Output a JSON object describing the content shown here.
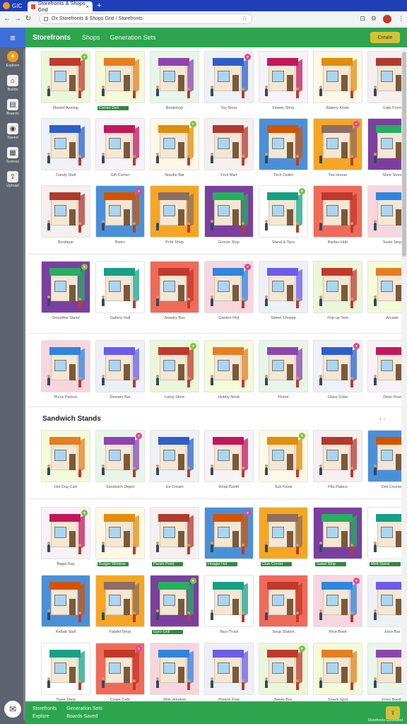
{
  "window": {
    "app_label": "GIC"
  },
  "tab": {
    "title": "Storefronts & Shops Grid",
    "close": "×",
    "new_tab": "+"
  },
  "address_bar": {
    "url": "Ox Storefronts & Shops Grid / Storefronts"
  },
  "sidebar": {
    "menu_icon": "menu-icon",
    "items": [
      {
        "label": "Explore",
        "icon": "bulb-icon",
        "glyph": "✦",
        "active": true
      },
      {
        "label": "Builds",
        "icon": "home-icon",
        "glyph": "⌂",
        "active": false
      },
      {
        "label": "Boards",
        "icon": "board-icon",
        "glyph": "▤",
        "active": false
      },
      {
        "label": "Saved",
        "icon": "pin-icon",
        "glyph": "◉",
        "active": false
      },
      {
        "label": "Scenes",
        "icon": "grid-icon",
        "glyph": "▦",
        "active": false
      },
      {
        "label": "Upload",
        "icon": "upload-icon",
        "glyph": "⇪",
        "active": false
      }
    ],
    "bottom_icon": "chat-icon"
  },
  "header": {
    "title": "Storefronts",
    "links": [
      "Shops",
      "Generation Sets"
    ],
    "button": "Create"
  },
  "section": {
    "title": "Sandwich Stands",
    "menu": "· ·"
  },
  "rows": [
    {
      "captions": [
        "Market Awning",
        "Corner Deli",
        "Bookshop",
        "Toy Store",
        "Flower Shop",
        "Bakery Kiosk",
        "Cafe Front"
      ],
      "green": [
        0,
        1,
        0,
        0,
        0,
        0,
        0
      ]
    },
    {
      "captions": [
        "Candy Stall",
        "Gift Corner",
        "Noodle Bar",
        "Fruit Mart",
        "Tech Outlet",
        "Tea House",
        "Shoe Store"
      ],
      "green": [
        0,
        0,
        0,
        0,
        0,
        0,
        0
      ]
    },
    {
      "captions": [
        "Boutique",
        "Bistro",
        "Print Shop",
        "Grocer Stop",
        "Stand & Taco",
        "Barber Hub",
        "Sushi Stop"
      ],
      "green": [
        0,
        0,
        0,
        0,
        0,
        0,
        0
      ]
    },
    {
      "captions": [
        "Smoothie Stand",
        "Gallery Hall",
        "Jewelry Box",
        "Garden Plot",
        "Sweet Shoppe",
        "Pop-up Tent",
        "Arcade"
      ],
      "green": [
        0,
        0,
        0,
        0,
        0,
        0,
        0
      ]
    },
    {
      "captions": [
        "Pizza Parlour",
        "Dessert Bar",
        "Lamp Store",
        "Hobby Nook",
        "Florist",
        "Glass Cube",
        "Diner Row"
      ],
      "green": [
        0,
        0,
        0,
        0,
        0,
        0,
        0
      ]
    },
    {
      "captions": [
        "Hot Dog Cart",
        "Sandwich Depot",
        "Ice Cream",
        "Wrap Booth",
        "Sub Kiosk",
        "Pita Palace",
        "Deli Counter"
      ],
      "green": [
        0,
        0,
        0,
        0,
        0,
        0,
        0
      ]
    },
    {
      "captions": [
        "Bagel Bay",
        "Burger Window",
        "Panini Point",
        "Hoagie Hut",
        "Club Corner",
        "Salad Stop",
        "Melt Stand"
      ],
      "green": [
        0,
        1,
        1,
        1,
        1,
        1,
        1
      ]
    },
    {
      "captions": [
        "Kebab Stall",
        "Falafel Shop",
        "Gyro Grill",
        "Taco Truck",
        "Soup Station",
        "Rice Bowl",
        "Juice Bar"
      ],
      "green": [
        0,
        0,
        1,
        0,
        0,
        0,
        0
      ]
    },
    {
      "captions": [
        "Toast Shop",
        "Crepe Cafe",
        "Wok Window",
        "Pretzel Post",
        "Bento Box",
        "Snack Spot",
        "Fries Booth"
      ],
      "green": [
        0,
        0,
        0,
        0,
        0,
        0,
        0
      ]
    }
  ],
  "footer": {
    "cols": [
      [
        "Storefronts",
        "Explore"
      ],
      [
        "Generation Sets",
        "Boards Saved"
      ]
    ],
    "button": "⇪",
    "small": "Storefronts Generated"
  },
  "colors": {
    "brand_green": "#2ea44f",
    "chrome_blue": "#1f3fb8",
    "accent_yellow": "#d4c236",
    "active_orange": "#f39c12"
  }
}
